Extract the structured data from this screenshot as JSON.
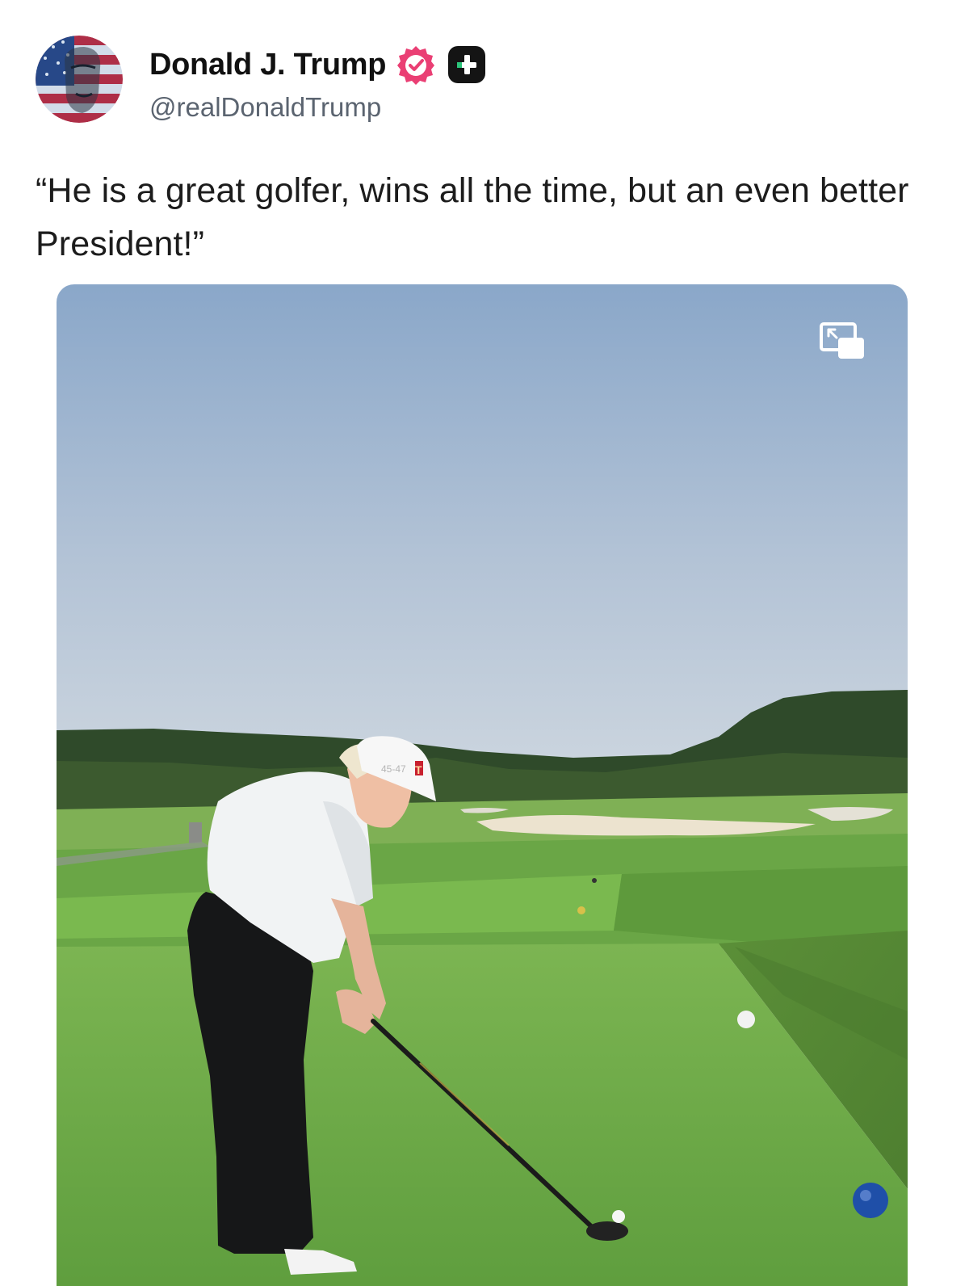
{
  "post": {
    "author": {
      "display_name": "Donald J. Trump",
      "handle": "@realDonaldTrump"
    },
    "text": "“He is a great golfer, wins all the time, but an even better President!”",
    "media": {
      "cap_text": "45-47",
      "cap_logo": "T"
    }
  },
  "colors": {
    "verified_badge": "#ea3f74",
    "plus_badge": "#141414",
    "handle_text": "#5b6470",
    "sky_top": "#8aa7c9",
    "sky_bottom": "#cdd6df",
    "fairway": "#6fae4a"
  },
  "icons": {
    "verified": "verified-check-icon",
    "plus": "plus-badge-icon",
    "pip": "picture-in-picture-icon"
  }
}
